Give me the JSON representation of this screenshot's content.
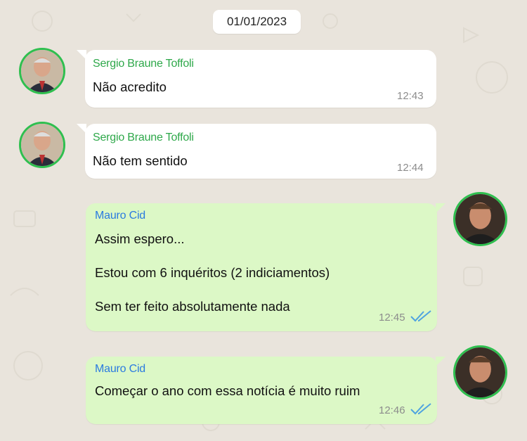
{
  "chat": {
    "date": "01/01/2023",
    "messages": [
      {
        "sender": "Sergio Braune Toffoli",
        "text": "Não acredito",
        "time": "12:43",
        "direction": "incoming"
      },
      {
        "sender": "Sergio Braune Toffoli",
        "text": "Não tem sentido",
        "time": "12:44",
        "direction": "incoming"
      },
      {
        "sender": "Mauro Cid",
        "lines": [
          "Assim espero...",
          "Estou com 6 inquéritos (2 indiciamentos)",
          "Sem ter feito absolutamente nada"
        ],
        "time": "12:45",
        "direction": "outgoing",
        "status": "read"
      },
      {
        "sender": "Mauro Cid",
        "text": "Começar o ano com essa notícia é muito ruim",
        "time": "12:46",
        "direction": "outgoing",
        "status": "read"
      }
    ]
  },
  "colors": {
    "background": "#e9e4dc",
    "incoming_bubble": "#ffffff",
    "outgoing_bubble": "#dcf8c6",
    "sender_incoming": "#2ea84a",
    "sender_outgoing": "#2b7be0",
    "read_ticks": "#4fa3e0",
    "avatar_border": "#2fbf4f"
  },
  "icons": {
    "read_receipt": "double-check-icon"
  }
}
